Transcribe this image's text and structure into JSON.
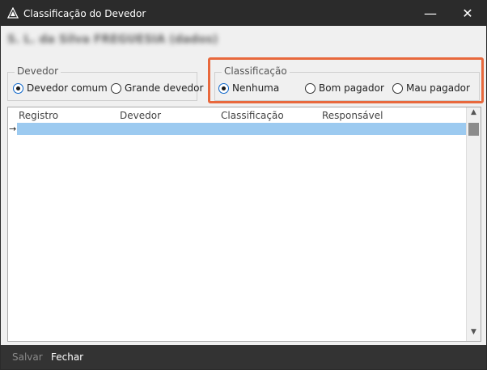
{
  "window": {
    "title": "Classificação do Devedor",
    "minimize_glyph": "—",
    "close_glyph": "✕"
  },
  "header": {
    "blurred_text": "S. L. da Silva FREGUESIA (dados)"
  },
  "devedor_group": {
    "title": "Devedor",
    "options": [
      {
        "label": "Devedor comum",
        "checked": true
      },
      {
        "label": "Grande devedor",
        "checked": false
      }
    ]
  },
  "classificacao_group": {
    "title": "Classificação",
    "options": [
      {
        "label": "Nenhuma",
        "checked": true
      },
      {
        "label": "Bom pagador",
        "checked": false
      },
      {
        "label": "Mau pagador",
        "checked": false
      }
    ]
  },
  "grid": {
    "columns": [
      "Registro",
      "Devedor",
      "Classificação",
      "Responsável"
    ],
    "row_indicator": "→",
    "scroll_up": "▲",
    "scroll_down": "▼"
  },
  "footer": {
    "save_label": "Salvar",
    "close_label": "Fechar"
  },
  "colors": {
    "highlight": "#e8683c",
    "selection": "#9ccaf0",
    "titlebar": "#2b2b2b"
  }
}
